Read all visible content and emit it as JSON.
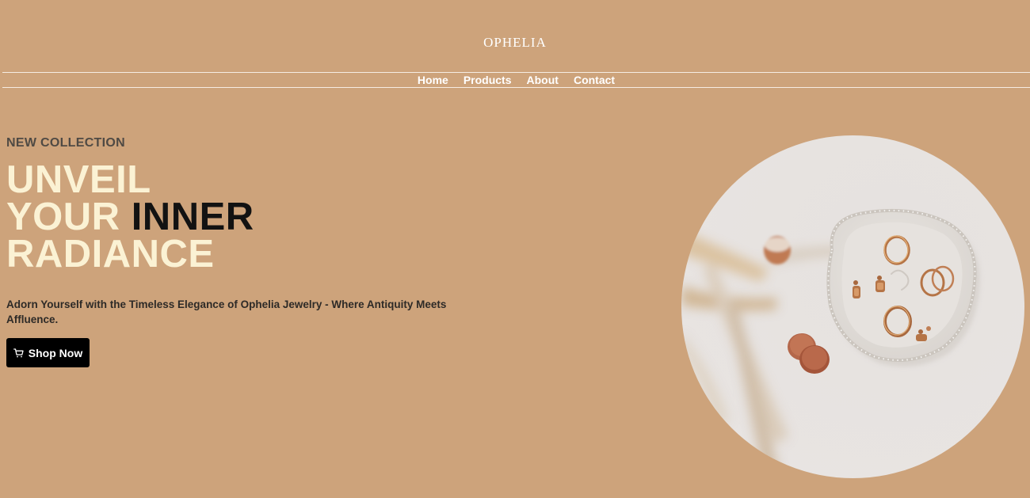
{
  "brand": {
    "logo_text": "OPHELIA"
  },
  "nav": {
    "items": [
      {
        "label": "Home"
      },
      {
        "label": "Products"
      },
      {
        "label": "About"
      },
      {
        "label": "Contact"
      }
    ]
  },
  "hero": {
    "eyebrow": "NEW COLLECTION",
    "headline_line1": "UNVEIL",
    "headline_line2_light": "YOUR ",
    "headline_line2_dark": "INNER",
    "headline_line3": "RADIANCE",
    "subtext": "Adorn Yourself with the Timeless Elegance of Ophelia Jewelry - Where Antiquity Meets Affluence.",
    "button_label": "Shop Now",
    "button_icon": "cart-icon",
    "image_icon": "jewelry-tray-photo"
  },
  "colors": {
    "background": "#cda37b",
    "headline_light": "#fbf2d4",
    "headline_dark": "#121212",
    "button_bg": "#000000"
  }
}
